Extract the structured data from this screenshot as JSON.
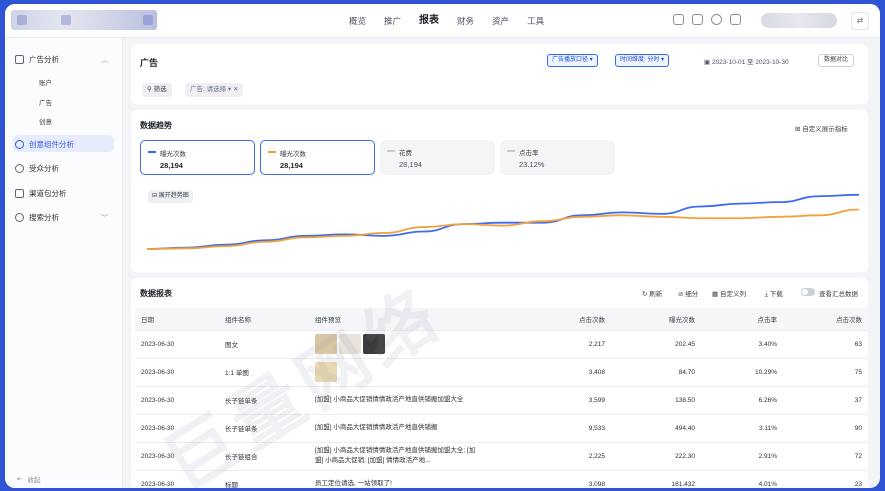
{
  "nav": {
    "items": [
      "概览",
      "推广",
      "报表",
      "财务",
      "资产",
      "工具"
    ],
    "active_index": 2
  },
  "sidebar": {
    "groups": [
      {
        "label": "广告分析",
        "subs": [
          "账户",
          "广告",
          "创意"
        ]
      },
      {
        "label": "创意组件分析",
        "active": true
      },
      {
        "label": "受众分析"
      },
      {
        "label": "渠道包分析"
      },
      {
        "label": "搜索分析"
      }
    ],
    "collapse_label": "收起"
  },
  "header": {
    "title": "广告",
    "filter_pill_1": "广告播放口径",
    "filter_pill_2": "时间维度: 分时",
    "date_range": "2023-10-01 至 2023-10-30",
    "compare_button": "数据对比",
    "filter_button": "筛选",
    "filter_tag": "广告: 请选择"
  },
  "trend": {
    "title": "数据趋势",
    "custom_metric": "自定义展示指标",
    "trend_button": "展开趋势图",
    "metrics": [
      {
        "label": "曝光次数",
        "value": "28,194",
        "color": "#3c6cf0",
        "selected": true
      },
      {
        "label": "曝光次数",
        "value": "28,194",
        "color": "#f0a23c",
        "selected": true
      },
      {
        "label": "花费",
        "value": "28,194",
        "color": "#c5c9d2",
        "selected": false
      },
      {
        "label": "点击率",
        "value": "23.12%",
        "color": "#c5c9d2",
        "selected": false
      }
    ]
  },
  "chart_data": {
    "type": "line",
    "x": [
      0,
      1,
      2,
      3,
      4,
      5,
      6,
      7,
      8,
      9,
      10,
      11,
      12,
      13,
      14,
      15,
      16,
      17,
      18
    ],
    "series": [
      {
        "name": "曝光次数",
        "color": "#3c6cf0",
        "values": [
          2,
          3,
          5,
          8,
          11,
          12,
          11,
          14,
          19,
          20,
          20,
          25,
          27,
          26,
          31,
          33,
          34,
          38,
          39
        ]
      },
      {
        "name": "曝光次数",
        "color": "#f0a23c",
        "values": [
          2,
          2.5,
          4,
          7,
          10,
          11,
          13,
          17,
          19,
          18,
          21,
          24,
          25,
          24,
          23,
          23,
          24,
          25,
          29
        ]
      }
    ],
    "ylim": [
      0,
      45
    ],
    "grid": false
  },
  "report": {
    "title": "数据报表",
    "tools": [
      "刷新",
      "细分",
      "自定义列",
      "下载",
      "查看汇总数据"
    ],
    "columns": [
      "日期",
      "组件名称",
      "组件预览",
      "点击次数",
      "曝光次数",
      "点击率",
      "点击次数"
    ],
    "rows": [
      {
        "date": "2023-06-30",
        "name": "图文",
        "preview": "",
        "c1": "2,217",
        "c2": "202.45",
        "c3": "3.40%",
        "c4": "63"
      },
      {
        "date": "2023-06-30",
        "name": "1:1 单图",
        "preview": "",
        "c1": "3,408",
        "c2": "84.70",
        "c3": "10.29%",
        "c4": "75"
      },
      {
        "date": "2023-06-30",
        "name": "长子链单条",
        "preview": "[加盟] 小商品大促销情情政活产地直供铺搬加盟大全",
        "c1": "3,599",
        "c2": "138.50",
        "c3": "6.26%",
        "c4": "37"
      },
      {
        "date": "2023-06-30",
        "name": "长子链单条",
        "preview": "[加盟] 小商品大促销情情政活产地直供铺搬",
        "c1": "9,533",
        "c2": "494.40",
        "c3": "3.11%",
        "c4": "90"
      },
      {
        "date": "2023-06-30",
        "name": "长子链组合",
        "preview": "[加盟] 小商品大促销情情政活产地直供铺搬加盟大全; [加盟] 小商品大促销; [加盟] 情情政活产地...",
        "c1": "2,225",
        "c2": "222.30",
        "c3": "2.91%",
        "c4": "72"
      },
      {
        "date": "2023-06-30",
        "name": "标题",
        "preview": "员工定位请选, 一站领取了!",
        "c1": "3,098",
        "c2": "161.432",
        "c3": "4.01%",
        "c4": "23"
      }
    ]
  },
  "watermark": "巨量网络"
}
